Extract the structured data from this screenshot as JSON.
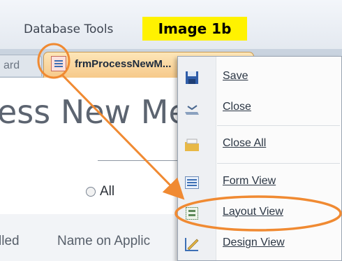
{
  "ribbon": {
    "tab_label": "Database Tools"
  },
  "caption": "Image 1b",
  "document_tabs": {
    "inactive_label": "ard",
    "active_label": "frmProcessNewM..."
  },
  "form": {
    "title": "ess New Mer",
    "radio_label": "All",
    "column_labels": [
      "lled",
      "Name on Applic"
    ]
  },
  "context_menu": {
    "items": [
      {
        "label": "Save",
        "icon": "save-icon"
      },
      {
        "label": "Close",
        "icon": "close-icon"
      },
      {
        "label": "Close All",
        "icon": "close-all-icon"
      },
      {
        "label": "Form View",
        "icon": "form-view-icon"
      },
      {
        "label": "Layout View",
        "icon": "layout-view-icon"
      },
      {
        "label": "Design View",
        "icon": "design-view-icon"
      }
    ]
  },
  "annotation": {
    "color": "#f08a32"
  }
}
